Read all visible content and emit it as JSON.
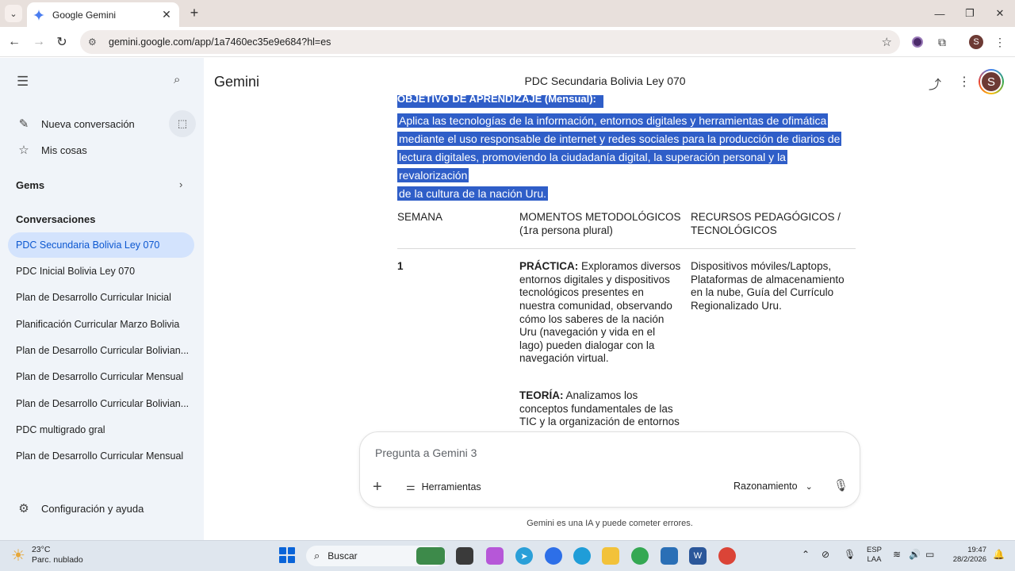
{
  "browser": {
    "tab_title": "Google Gemini",
    "url": "gemini.google.com/app/1a7460ec35e9e684?hl=es",
    "profile_initial": "S"
  },
  "sidebar": {
    "new_chat": "Nueva conversación",
    "my_stuff": "Mis cosas",
    "gems": "Gems",
    "conversations_title": "Conversaciones",
    "conversations": [
      "PDC Secundaria Bolivia Ley 070",
      "PDC Inicial Bolivia Ley 070",
      "Plan de Desarrollo Curricular Inicial",
      "Planificación Curricular Marzo Bolivia",
      "Plan de Desarrollo Curricular Bolivian...",
      "Plan de Desarrollo Curricular Mensual",
      "Plan de Desarrollo Curricular Bolivian...",
      "PDC multigrado gral",
      "Plan de Desarrollo Curricular Mensual"
    ],
    "settings": "Configuración y ayuda"
  },
  "header": {
    "brand": "Gemini",
    "title": "PDC Secundaria Bolivia Ley 070",
    "avatar_initial": "S"
  },
  "content": {
    "objective_header": "OBJETIVO DE APRENDIZAJE (Mensual):",
    "objective_lines": [
      "Aplica las tecnologías de la información, entornos digitales y herramientas de ofimática",
      "mediante el uso responsable de internet y redes sociales para la producción de diarios de",
      "lectura digitales, promoviendo la ciudadanía digital, la superación personal y la revalorización",
      "de la cultura de la nación Uru."
    ],
    "table": {
      "headers": [
        "SEMANA",
        "MOMENTOS METODOLÓGICOS (1ra persona plural)",
        "RECURSOS PEDAGÓGICOS / TECNOLÓGICOS"
      ],
      "row1": {
        "week": "1",
        "practice_label": "PRÁCTICA:",
        "practice_text": " Exploramos diversos entornos digitales y dispositivos tecnológicos presentes en nuestra comunidad, observando cómo los saberes de la nación Uru (navegación y vida en el lago) pueden dialogar con la navegación virtual.",
        "theory_label": "TEORÍA:",
        "theory_text": " Analizamos los conceptos fundamentales de las TIC y la organización de entornos",
        "resources": "Dispositivos móviles/Laptops, Plataformas de almacenamiento en la nube, Guía del Currículo Regionalizado Uru."
      }
    }
  },
  "input": {
    "placeholder": "Pregunta a Gemini 3",
    "tools": "Herramientas",
    "model": "Razonamiento",
    "disclaimer": "Gemini es una IA y puede cometer errores."
  },
  "taskbar": {
    "temperature": "23°C",
    "weather": "Parc. nublado",
    "search": "Buscar",
    "lang_line1": "ESP",
    "lang_line2": "LAA",
    "time": "19:47",
    "date": "28/2/2026"
  }
}
